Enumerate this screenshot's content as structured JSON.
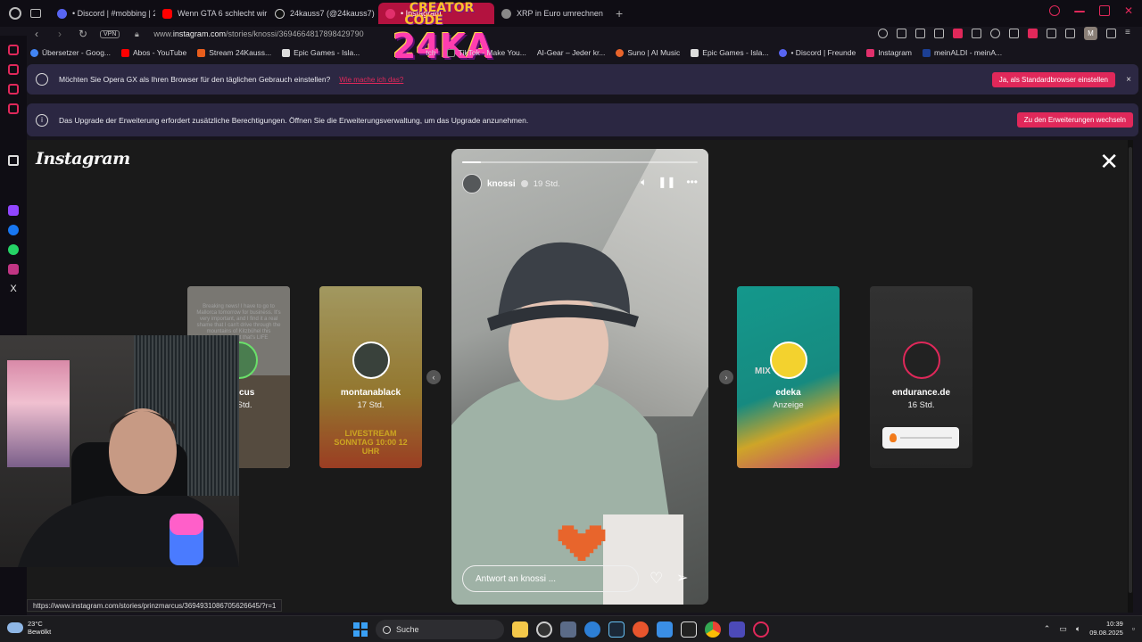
{
  "tabs": [
    {
      "label": "• Discord | #mobbing | 24",
      "color": "#5865f2"
    },
    {
      "label": "Wenn GTA 6 schlecht wir",
      "color": "#ff0000"
    },
    {
      "label": "24kauss7 (@24kauss7)",
      "color": "#111111"
    },
    {
      "label": "• Instagram",
      "color": "#e1306c",
      "active": true
    },
    {
      "label": "XRP in Euro umrechnen",
      "color": "#888888"
    }
  ],
  "tab_add": "+",
  "overlay_logo": {
    "line1": "CREATOR",
    "line2": "CODE",
    "line3": "24KA"
  },
  "address": {
    "vpn": "VPN",
    "url_prefix": "www.",
    "url_domain": "instagram.com",
    "url_path": "/stories/knossi/3694664817898429790",
    "avatar_letter": "M"
  },
  "bookmarks": [
    {
      "label": "Übersetzer - Goog...",
      "color": "#4285f4"
    },
    {
      "label": "Abos - YouTube",
      "color": "#ff0000"
    },
    {
      "label": "Stream 24Kauss...",
      "color": "#e85d1c"
    },
    {
      "label": "Epic Games - Isla...",
      "color": "#dddddd"
    },
    {
      "label": "tch",
      "color": "#9146ff"
    },
    {
      "label": "TikTok - Make You...",
      "color": "#111111"
    },
    {
      "label": "AI-Gear – Jeder kr...",
      "color": "#333333"
    },
    {
      "label": "Suno | AI Music",
      "color": "#e8642b"
    },
    {
      "label": "Epic Games - Isla...",
      "color": "#dddddd"
    },
    {
      "label": "• Discord | Freunde",
      "color": "#5865f2"
    },
    {
      "label": "Instagram",
      "color": "#e1306c"
    },
    {
      "label": "meinALDI - meinA...",
      "color": "#1c3f94"
    }
  ],
  "notification1": {
    "text": "Möchten Sie Opera GX als Ihren Browser für den täglichen Gebrauch einstellen?",
    "link": "Wie mache ich das?",
    "button": "Ja, als Standardbrowser einstellen",
    "close": "×"
  },
  "notification2": {
    "text": "Das Upgrade der Erweiterung erfordert zusätzliche Berechtigungen. Öffnen Sie die Erweiterungsverwaltung, um das Upgrade anzunehmen.",
    "button": "Zu den Erweiterungen wechseln"
  },
  "instagram": {
    "logo": "Instagram",
    "close": "✕",
    "side_stories": [
      {
        "name": "marcus",
        "time": "15 Std.",
        "bg": "#c4c1b8",
        "text": "Breaking news! I have to go to Mallorca tomorrow for business. It's very important, and I find it a real shame that I can't drive through the mountains of Kitzbühel this weekend, but that's LIFE"
      },
      {
        "name": "montanablack",
        "time": "17 Std.",
        "bg": "#b8a44a",
        "text": "LIVESTREAM SONNTAG 10:00 12 UHR"
      },
      {
        "name": "edeka",
        "time": "Anzeige",
        "bg": "#17a89b",
        "text": "MIX"
      },
      {
        "name": "endurance.de",
        "time": "16 Std.",
        "bg": "#3b3b3b",
        "text": ""
      }
    ],
    "story": {
      "user": "knossi",
      "time": "19 Std.",
      "progress": 0.08,
      "reply_placeholder": "Antwort an knossi ..."
    }
  },
  "status_url": "https://www.instagram.com/stories/prinzmarcus/3694931086705626645/?r=1",
  "taskbar": {
    "weather_temp": "23°C",
    "weather_desc": "Bewölkt",
    "search": "Suche",
    "time": "10:39",
    "date": "09.08.2025"
  }
}
